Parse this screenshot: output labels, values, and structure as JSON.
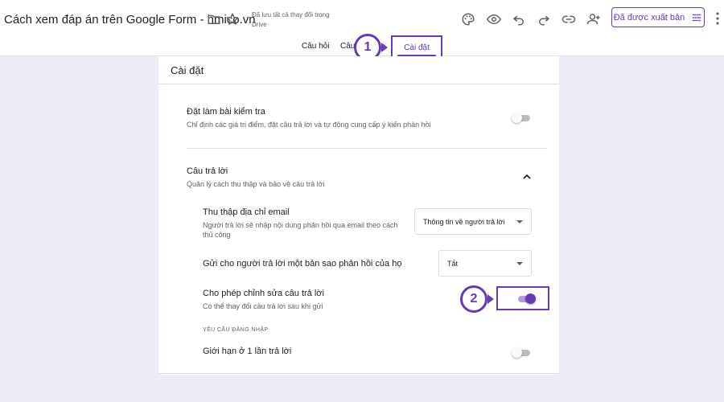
{
  "header": {
    "title": "Cách xem đáp án trên Google Form - hmico.vn",
    "save_status_line1": "Đã lưu tất cả thay đổi trong",
    "save_status_line2": "Drive",
    "publish_label": "Đã được xuất bản"
  },
  "tabs": {
    "questions": "Câu hỏi",
    "responses_partial": "Câu",
    "settings": "Cài đặt"
  },
  "steps": {
    "one": "1",
    "two": "2"
  },
  "settings": {
    "card_title": "Cài đặt",
    "quiz": {
      "title": "Đặt làm bài kiểm tra",
      "description": "Chỉ định các giá trị điểm, đặt câu trả lời và tự động cung cấp ý kiến phản hồi"
    },
    "responses": {
      "title": "Câu trả lời",
      "description": "Quản lý cách thu thập và bảo vệ câu trả lời",
      "collect_email": {
        "title": "Thu thập địa chỉ email",
        "description": "Người trả lời sẽ nhập nội dung phản hồi qua email theo cách thủ công",
        "selected": "Thông tin về người trả lời"
      },
      "send_copy": {
        "title": "Gửi cho người trả lời một bản sao phản hồi của họ",
        "selected": "Tắt"
      },
      "allow_edit": {
        "title": "Cho phép chỉnh sửa câu trả lời",
        "description": "Có thể thay đổi câu trả lời sau khi gửi"
      },
      "login_required_heading": "YÊU CẦU ĐĂNG NHẬP",
      "limit_one": {
        "title": "Giới hạn ở 1 lần trả lời"
      }
    }
  },
  "colors": {
    "accent": "#673ab7",
    "background": "#efecf8"
  }
}
